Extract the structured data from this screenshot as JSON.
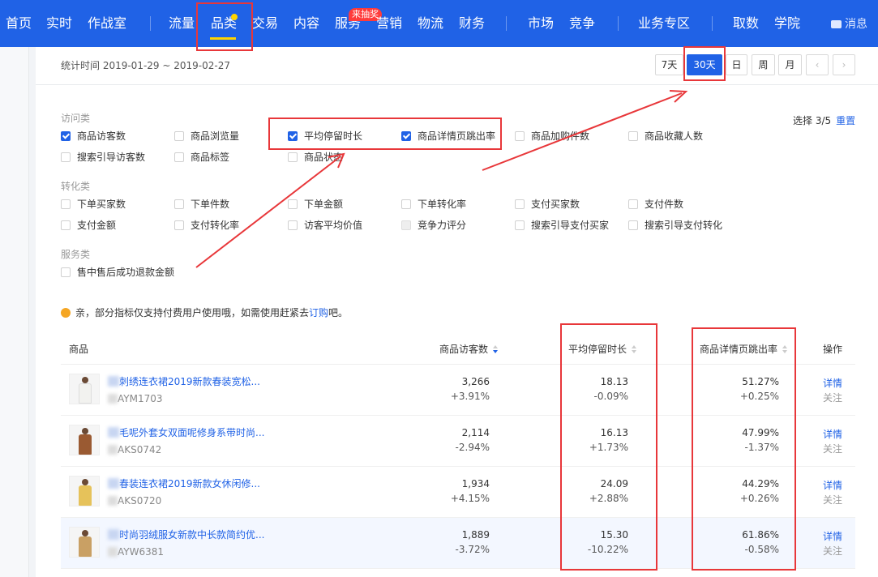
{
  "nav": {
    "items": [
      "首页",
      "实时",
      "作战室",
      "流量",
      "品类",
      "交易",
      "内容",
      "服务",
      "营销",
      "物流",
      "财务",
      "市场",
      "竞争",
      "业务专区",
      "取数",
      "学院"
    ],
    "badge": "来抽奖",
    "message": "消息"
  },
  "header": {
    "time_label": "统计时间 2019-01-29 ~ 2019-02-27",
    "periods": [
      "7天",
      "30天",
      "日",
      "周",
      "月"
    ],
    "prev": "‹",
    "next": "›"
  },
  "selector": {
    "count_label": "选择 3/5",
    "reset_label": "重置",
    "groups": [
      {
        "title": "访问类",
        "items": [
          {
            "label": "商品访客数",
            "checked": true
          },
          {
            "label": "商品浏览量",
            "checked": false
          },
          {
            "label": "平均停留时长",
            "checked": true
          },
          {
            "label": "商品详情页跳出率",
            "checked": true
          },
          {
            "label": "商品加购件数",
            "checked": false
          },
          {
            "label": "商品收藏人数",
            "checked": false
          },
          {
            "label": "搜索引导访客数",
            "checked": false
          },
          {
            "label": "商品标签",
            "checked": false
          },
          {
            "label": "商品状态",
            "checked": false
          }
        ]
      },
      {
        "title": "转化类",
        "items": [
          {
            "label": "下单买家数",
            "checked": false
          },
          {
            "label": "下单件数",
            "checked": false
          },
          {
            "label": "下单金额",
            "checked": false
          },
          {
            "label": "下单转化率",
            "checked": false
          },
          {
            "label": "支付买家数",
            "checked": false
          },
          {
            "label": "支付件数",
            "checked": false
          },
          {
            "label": "支付金额",
            "checked": false
          },
          {
            "label": "支付转化率",
            "checked": false
          },
          {
            "label": "访客平均价值",
            "checked": false
          },
          {
            "label": "竞争力评分",
            "checked": false,
            "disabled": true
          },
          {
            "label": "搜索引导支付买家",
            "checked": false
          },
          {
            "label": "搜索引导支付转化",
            "checked": false
          }
        ]
      },
      {
        "title": "服务类",
        "items": [
          {
            "label": "售中售后成功退款金额",
            "checked": false
          }
        ]
      }
    ]
  },
  "notice": {
    "text": "亲，部分指标仅支持付费用户使用哦，如需使用赶紧去",
    "link": "订购",
    "suffix": "吧。"
  },
  "table": {
    "columns": [
      "商品",
      "商品访客数",
      "平均停留时长",
      "商品详情页跳出率",
      "操作"
    ],
    "rows": [
      {
        "name": "刺绣连衣裙2019新款春装宽松...",
        "code": "AYM1703",
        "visitors": "3,266",
        "visitors_delta": "+3.91%",
        "stay": "18.13",
        "stay_delta": "-0.09%",
        "bounce": "51.27%",
        "bounce_delta": "+0.25%",
        "color": "#f2f2ef"
      },
      {
        "name": "毛呢外套女双面呢修身系带时尚...",
        "code": "AKS0742",
        "visitors": "2,114",
        "visitors_delta": "-2.94%",
        "stay": "16.13",
        "stay_delta": "+1.73%",
        "bounce": "47.99%",
        "bounce_delta": "-1.37%",
        "color": "#9a5a32"
      },
      {
        "name": "春装连衣裙2019新款女休闲修...",
        "code": "AKS0720",
        "visitors": "1,934",
        "visitors_delta": "+4.15%",
        "stay": "24.09",
        "stay_delta": "+2.88%",
        "bounce": "44.29%",
        "bounce_delta": "+0.26%",
        "color": "#e6c25a"
      },
      {
        "name": "时尚羽绒服女新款中长款简约优...",
        "code": "AYW6381",
        "visitors": "1,889",
        "visitors_delta": "-3.72%",
        "stay": "15.30",
        "stay_delta": "-10.22%",
        "bounce": "61.86%",
        "bounce_delta": "-0.58%",
        "color": "#c9a064"
      }
    ],
    "op_detail": "详情",
    "op_follow": "关注"
  },
  "colors": {
    "nav_bg": "#2062e6",
    "accent": "#2062e6",
    "annotation": "#e8373a",
    "highlight": "#ffd400"
  }
}
